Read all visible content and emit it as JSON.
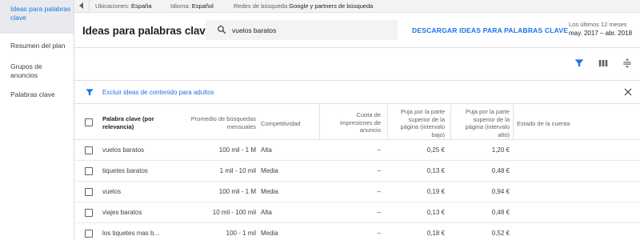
{
  "sidebar": {
    "items": [
      {
        "label": "Ideas para palabras clave",
        "active": true
      },
      {
        "label": "Resumen del plan",
        "active": false
      },
      {
        "label": "Grupos de anuncios",
        "active": false
      },
      {
        "label": "Palabras clave",
        "active": false
      }
    ]
  },
  "topbar": {
    "locations_label": "Ubicaciones:",
    "locations_value": "España",
    "language_label": "Idioma:",
    "language_value": "Español",
    "networks_label": "Redes de búsqueda",
    "networks_value": "Google y partners de búsqueda"
  },
  "header": {
    "title": "Ideas para palabras clave",
    "search_value": "vuelos baratos",
    "download_label": "DESCARGAR IDEAS PARA PALABRAS CLAVE",
    "date_label": "Los últimos 12 meses",
    "date_range": "may. 2017 – abr. 2018"
  },
  "banner": {
    "text": "Excluir ideas de contenido para adultos"
  },
  "table": {
    "columns": [
      "Palabra clave (por relevancia)",
      "Promedio de búsquedas mensuales",
      "Competitividad",
      "Cuota de impresiones de anuncio",
      "Puja por la parte superior de la página (intervalo bajo)",
      "Puja por la parte superior de la página (intervalo alto)",
      "Estado de la cuenta"
    ],
    "rows": [
      {
        "keyword": "vuelos baratos",
        "searches": "100 mil - 1 M",
        "competition": "Alta",
        "impression_share": "–",
        "bid_low": "0,25 €",
        "bid_high": "1,20 €"
      },
      {
        "keyword": "tiquetes baratos",
        "searches": "1 mil - 10 mil",
        "competition": "Media",
        "impression_share": "–",
        "bid_low": "0,13 €",
        "bid_high": "0,48 €"
      },
      {
        "keyword": "vuelos",
        "searches": "100 mil - 1 M",
        "competition": "Media",
        "impression_share": "–",
        "bid_low": "0,19 €",
        "bid_high": "0,94 €"
      },
      {
        "keyword": "viajes baratos",
        "searches": "10 mil - 100 mil",
        "competition": "Alta",
        "impression_share": "–",
        "bid_low": "0,13 €",
        "bid_high": "0,48 €"
      },
      {
        "keyword": "los tiquetes mas b...",
        "searches": "100 - 1 mil",
        "competition": "Media",
        "impression_share": "–",
        "bid_low": "0,18 €",
        "bid_high": "0,52 €"
      }
    ]
  },
  "colors": {
    "accent": "#1a73e8",
    "sidebar_active_bg": "#e8eaed",
    "topbar_bg": "#f1f3f4"
  },
  "icons": [
    "back-triangle-icon",
    "search-icon",
    "filter-icon",
    "columns-icon",
    "row-density-icon",
    "close-icon"
  ]
}
